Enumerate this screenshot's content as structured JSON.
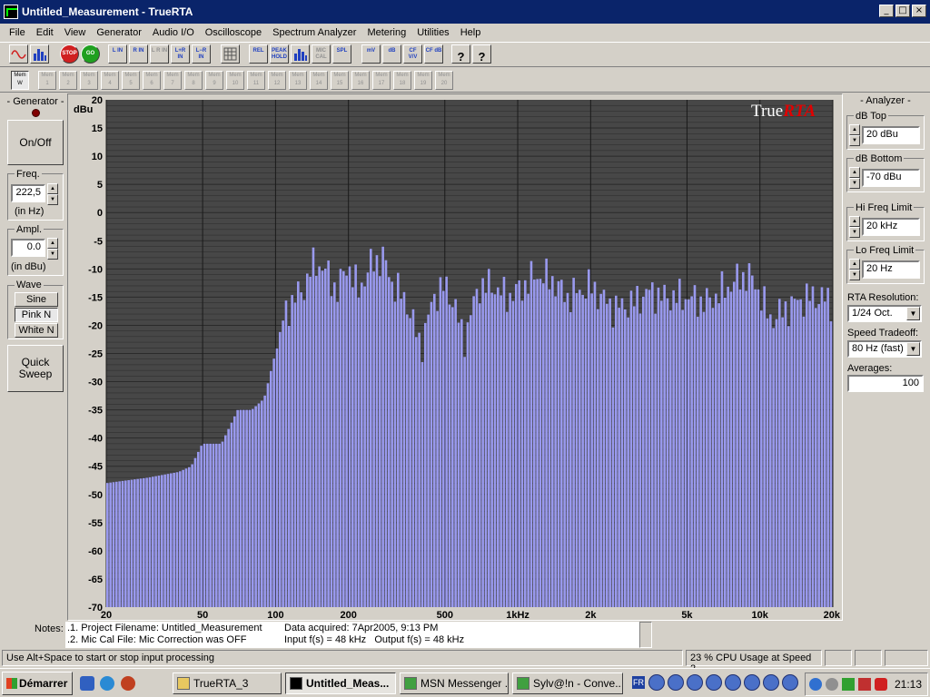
{
  "window": {
    "title": "Untitled_Measurement - TrueRTA"
  },
  "menu": [
    "File",
    "Edit",
    "View",
    "Generator",
    "Audio I/O",
    "Oscilloscope",
    "Spectrum Analyzer",
    "Metering",
    "Utilities",
    "Help"
  ],
  "toolbar1": [
    {
      "label": "",
      "icon": "sine-wave-icon"
    },
    {
      "label": "",
      "icon": "spectrum-icon"
    },
    {
      "label": "STOP",
      "icon": "stop-icon"
    },
    {
      "label": "GO",
      "icon": "go-icon"
    },
    {
      "label": "L IN",
      "icon": "left-in-icon"
    },
    {
      "label": "R IN",
      "icon": "right-in-icon"
    },
    {
      "label": "L R IN",
      "icon": "lr-in-icon"
    },
    {
      "label": "L+R IN",
      "icon": "l-plus-r-in-icon"
    },
    {
      "label": "L−R IN",
      "icon": "l-minus-r-in-icon"
    },
    {
      "label": "",
      "icon": "grid-icon"
    },
    {
      "label": "REL",
      "icon": "rel-icon"
    },
    {
      "label": "PEAK HOLD",
      "icon": "peak-hold-icon"
    },
    {
      "label": "",
      "icon": "bar-graph-icon"
    },
    {
      "label": "MIC CAL",
      "icon": "mic-cal-icon"
    },
    {
      "label": "SPL",
      "icon": "spl-icon"
    },
    {
      "label": "mV",
      "icon": "mv-icon"
    },
    {
      "label": "dB",
      "icon": "db-icon"
    },
    {
      "label": "CF V/V",
      "icon": "cf-vv-icon"
    },
    {
      "label": "CF dB",
      "icon": "cf-db-icon"
    },
    {
      "label": "?",
      "icon": "help-icon"
    },
    {
      "label": "?",
      "icon": "context-help-icon"
    }
  ],
  "memory": {
    "current": "Mem W",
    "slots": [
      "1",
      "2",
      "3",
      "4",
      "5",
      "6",
      "7",
      "8",
      "9",
      "10",
      "11",
      "12",
      "13",
      "14",
      "15",
      "16",
      "17",
      "18",
      "19",
      "20"
    ]
  },
  "generator": {
    "title": "- Generator -",
    "onoff": "On/Off",
    "freq_label": "Freq.",
    "freq_value": "222,5",
    "freq_unit": "(in Hz)",
    "ampl_label": "Ampl.",
    "ampl_value": "0.0",
    "ampl_unit": "(in dBu)",
    "wave_label": "Wave",
    "waves": [
      "Sine",
      "Pink N",
      "White N"
    ],
    "selected_wave": "Pink N",
    "quick_sweep": "Quick Sweep"
  },
  "analyzer": {
    "title": "- Analyzer -",
    "db_top_label": "dB Top",
    "db_top": "20 dBu",
    "db_bottom_label": "dB Bottom",
    "db_bottom": "-70 dBu",
    "hi_label": "Hi Freq Limit",
    "hi": "20 kHz",
    "lo_label": "Lo Freq Limit",
    "lo": "20 Hz",
    "res_label": "RTA Resolution:",
    "res": "1/24 Oct.",
    "speed_label": "Speed Tradeoff:",
    "speed": "80 Hz (fast)",
    "avg_label": "Averages:",
    "avg": "100"
  },
  "chart_data": {
    "type": "bar",
    "brand": "TrueRTA",
    "ylabel": "dBu",
    "ylim": [
      -70,
      20
    ],
    "yticks": [
      20,
      15,
      10,
      5,
      0,
      -5,
      -10,
      -15,
      -20,
      -25,
      -30,
      -35,
      -40,
      -45,
      -50,
      -55,
      -60,
      -65,
      -70
    ],
    "ytick_labels": [
      "20",
      "15",
      "10",
      "5",
      "0",
      "-5",
      "-10",
      "-15",
      "-20",
      "-25",
      "-30",
      "-35",
      "-40",
      "-45",
      "-50",
      "-55",
      "-60",
      "-65",
      "-70"
    ],
    "xscale": "log",
    "xlim": [
      20,
      20000
    ],
    "xticks": [
      20,
      50,
      100,
      200,
      500,
      1000,
      2000,
      5000,
      10000,
      20000
    ],
    "xtick_labels": [
      "20",
      "50",
      "100",
      "200",
      "500",
      "1kHz",
      "2k",
      "5k",
      "10k",
      "20k"
    ],
    "grid": true,
    "colors": {
      "background": "#474747",
      "bar": "#9999ee",
      "grid": "#2a2a2a",
      "brand_true": "#ffffff",
      "brand_rta": "#e00000"
    },
    "spectrum_shape": [
      [
        20,
        -48
      ],
      [
        30,
        -47
      ],
      [
        40,
        -46
      ],
      [
        45,
        -45
      ],
      [
        50,
        -41
      ],
      [
        60,
        -41
      ],
      [
        70,
        -35
      ],
      [
        80,
        -35
      ],
      [
        90,
        -33
      ],
      [
        100,
        -25
      ],
      [
        110,
        -18
      ],
      [
        120,
        -15
      ],
      [
        130,
        -14
      ],
      [
        140,
        -10
      ],
      [
        150,
        -9
      ],
      [
        160,
        -10
      ],
      [
        180,
        -14
      ],
      [
        200,
        -9
      ],
      [
        220,
        -14
      ],
      [
        250,
        -9
      ],
      [
        280,
        -8
      ],
      [
        300,
        -12
      ],
      [
        350,
        -16
      ],
      [
        400,
        -24
      ],
      [
        450,
        -15
      ],
      [
        500,
        -13
      ],
      [
        550,
        -16
      ],
      [
        600,
        -23
      ],
      [
        650,
        -17
      ],
      [
        700,
        -13
      ],
      [
        800,
        -13
      ],
      [
        900,
        -15
      ],
      [
        1000,
        -14
      ],
      [
        1200,
        -11
      ],
      [
        1400,
        -12
      ],
      [
        1600,
        -15
      ],
      [
        1800,
        -14
      ],
      [
        2000,
        -13
      ],
      [
        2500,
        -17
      ],
      [
        3000,
        -16
      ],
      [
        3500,
        -14
      ],
      [
        4000,
        -15
      ],
      [
        5000,
        -15
      ],
      [
        6000,
        -16
      ],
      [
        7000,
        -14
      ],
      [
        8000,
        -12
      ],
      [
        9000,
        -11
      ],
      [
        10000,
        -14
      ],
      [
        11000,
        -19
      ],
      [
        12000,
        -18
      ],
      [
        14000,
        -16
      ],
      [
        16000,
        -15
      ],
      [
        18000,
        -15
      ],
      [
        20000,
        -16
      ]
    ]
  },
  "notes": {
    "label": "Notes:",
    "line1": ".1. Project Filename: Untitled_Measurement",
    "line2": ".2. Mic Cal File: Mic Correction was OFF",
    "acquired": "Data acquired: 7Apr2005, 9:13 PM",
    "rates": "Input f(s) = 48 kHz   Output f(s) = 48 kHz"
  },
  "status": {
    "hint": "Use Alt+Space to start or stop input processing",
    "cpu": "23 % CPU Usage at Speed 2"
  },
  "taskbar": {
    "start": "Démarrer",
    "tasks": [
      "TrueRTA_3",
      "Untitled_Meas...",
      "MSN Messenger ...",
      "Sylv@!n - Conve..."
    ],
    "lang": "FR",
    "clock": "21:13"
  }
}
